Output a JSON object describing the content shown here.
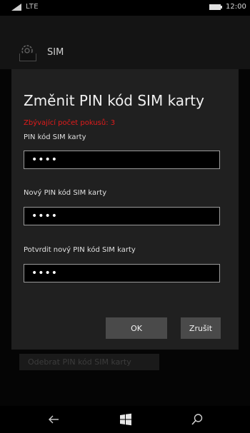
{
  "status_bar": {
    "network": "LTE",
    "time": "12:00",
    "signal_icon": "signal-icon",
    "battery_icon": "battery-icon"
  },
  "app_header": {
    "title": "SIM",
    "icon": "gear-icon"
  },
  "background": {
    "button_label": "Odebrat PIN kód SIM karty"
  },
  "dialog": {
    "title": "Změnit PIN kód SIM karty",
    "attempts_text": "Zbývající počet pokusů: 3",
    "fields": [
      {
        "label": "PIN kód SIM karty",
        "value": "••••"
      },
      {
        "label": "Nový PIN kód SIM karty",
        "value": "••••"
      },
      {
        "label": "Potvrdit nový PIN kód SIM karty",
        "value": "••••"
      }
    ],
    "ok_label": "OK",
    "cancel_label": "Zrušit"
  },
  "nav_bar": {
    "back_icon": "back-arrow-icon",
    "start_icon": "windows-start-icon",
    "search_icon": "search-icon"
  },
  "colors": {
    "warning": "#e21b1b",
    "dialog_bg": "#202020",
    "button_bg": "#4a4a4a"
  }
}
